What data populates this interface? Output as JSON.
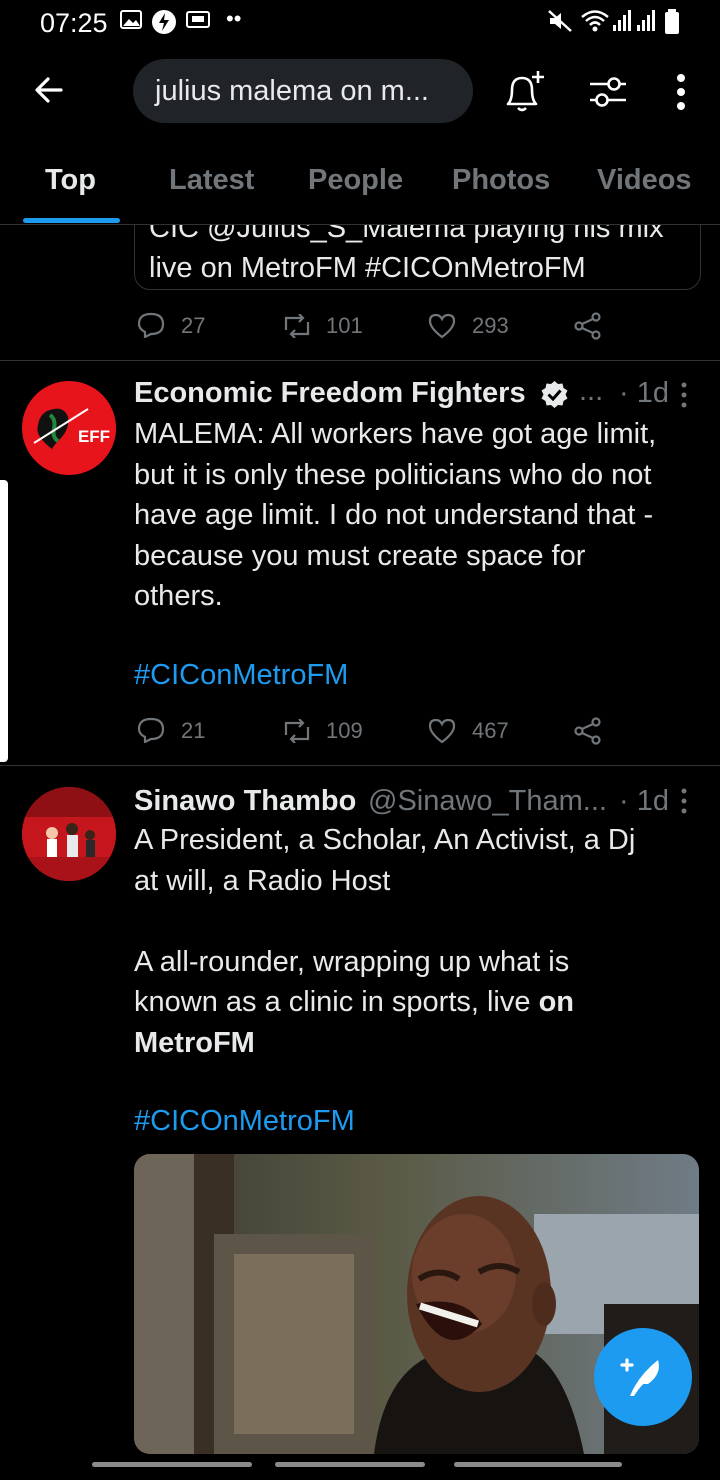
{
  "status_bar": {
    "time": "07:25"
  },
  "search": {
    "query": "julius malema on m..."
  },
  "tabs": [
    "Top",
    "Latest",
    "People",
    "Photos",
    "Videos"
  ],
  "tweet_prev": {
    "line1": "CIC @Julius_S_Malema playing his mix",
    "line2": "live on MetroFM #CICOnMetroFM",
    "replies": "27",
    "retweets": "101",
    "likes": "293"
  },
  "tweet_eff": {
    "name": "Economic Freedom Fighters",
    "ellipsis": "...",
    "time": "· 1d",
    "avatar_text": "EFF",
    "lines": [
      "MALEMA: All workers have got age limit,",
      "but it is only these politicians who do not",
      "have age limit. I do not understand that -",
      "because you must create space for",
      "others."
    ],
    "hashtag": "#CIConMetroFM",
    "replies": "21",
    "retweets": "109",
    "likes": "467"
  },
  "tweet_sinawo": {
    "name": "Sinawo Thambo",
    "handle": "@Sinawo_Tham...",
    "time": "· 1d",
    "line1": "A President, a Scholar, An Activist, a Dj",
    "line2": "at will, a Radio Host",
    "line3": "A all-rounder, wrapping up what is",
    "line4": "known as a clinic in sports, live",
    "line4_bold": "on",
    "line5_bold": "MetroFM",
    "hashtag": "#CICOnMetroFM"
  },
  "colors": {
    "accent": "#1d9bf0",
    "background": "#000000",
    "muted": "#71767b"
  }
}
